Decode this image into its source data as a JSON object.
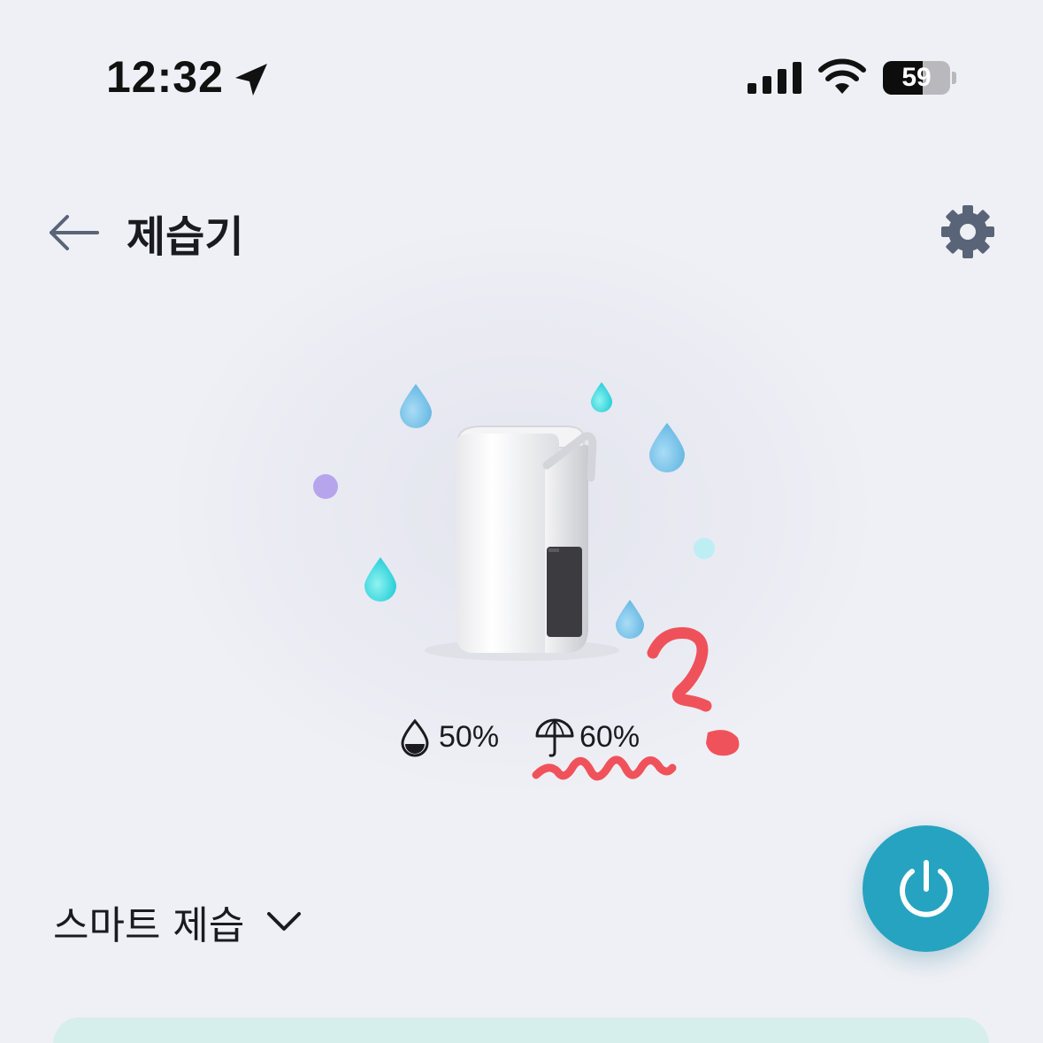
{
  "status_bar": {
    "time": "12:32",
    "battery_percent": "59",
    "battery_level": 0.59,
    "icons": [
      "location-arrow-icon",
      "cellular-signal-icon",
      "wifi-icon",
      "battery-icon"
    ]
  },
  "header": {
    "title": "제습기",
    "back_icon": "back-arrow-icon",
    "settings_icon": "gear-icon"
  },
  "device": {
    "image": "dehumidifier-illustration",
    "current_humidity": "50%",
    "target_humidity": "60%",
    "current_humidity_icon": "water-drop-icon",
    "target_humidity_icon": "umbrella-icon"
  },
  "mode": {
    "label": "스마트 제습",
    "icon": "chevron-down-icon"
  },
  "power": {
    "icon": "power-icon",
    "color": "#26a3c0"
  },
  "colors": {
    "background": "#eff0f5",
    "accent": "#26a3c0",
    "card": "#d7efec",
    "annotation": "#f0404a"
  }
}
